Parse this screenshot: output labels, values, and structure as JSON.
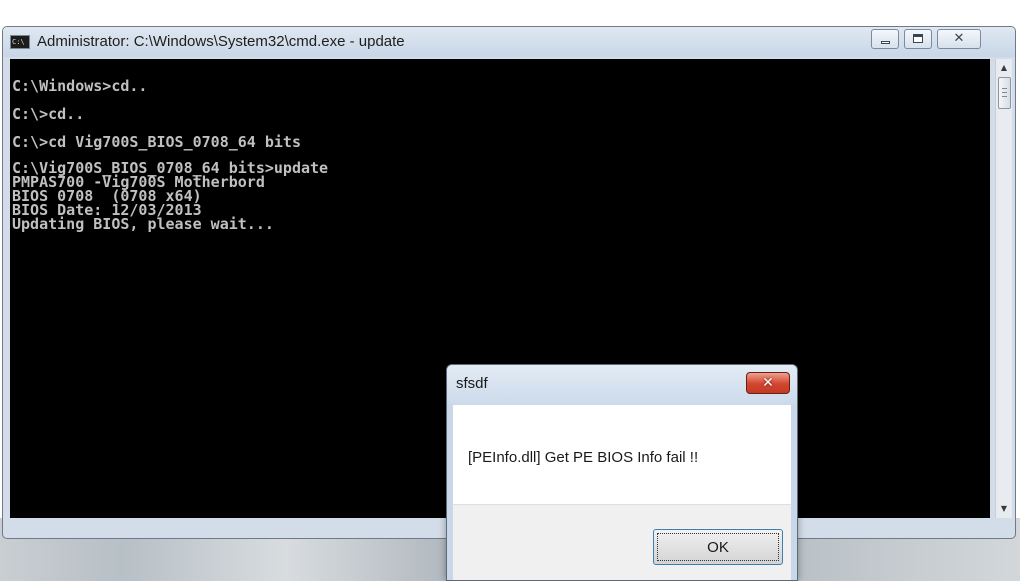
{
  "cmd_window": {
    "title": "Administrator: C:\\Windows\\System32\\cmd.exe - update",
    "app_icon_text": "C:\\",
    "console_lines": [
      "C:\\Windows>cd..",
      "C:\\>cd..",
      "C:\\>cd Vig700S_BIOS_0708_64 bits",
      "C:\\Vig700S_BIOS_0708_64 bits>update",
      "PMPAS700 -Vig700S Motherbord",
      "BIOS 0708  (0708 x64)",
      "BIOS Date: 12/03/2013",
      "Updating BIOS, please wait..."
    ],
    "buttons": {
      "minimize_icon": "minimize-icon",
      "maximize_icon": "maximize-icon",
      "close_glyph": "✕"
    },
    "scrollbar": {
      "up_glyph": "▲",
      "down_glyph": "▼"
    }
  },
  "dialog": {
    "title": "sfsdf",
    "close_glyph": "✕",
    "message": "[PEInfo.dll] Get PE BIOS Info fail !!",
    "ok_label": "OK"
  },
  "colors": {
    "console_background": "#000000",
    "console_text": "#c0c0c0",
    "dialog_close": "#d2452f"
  }
}
